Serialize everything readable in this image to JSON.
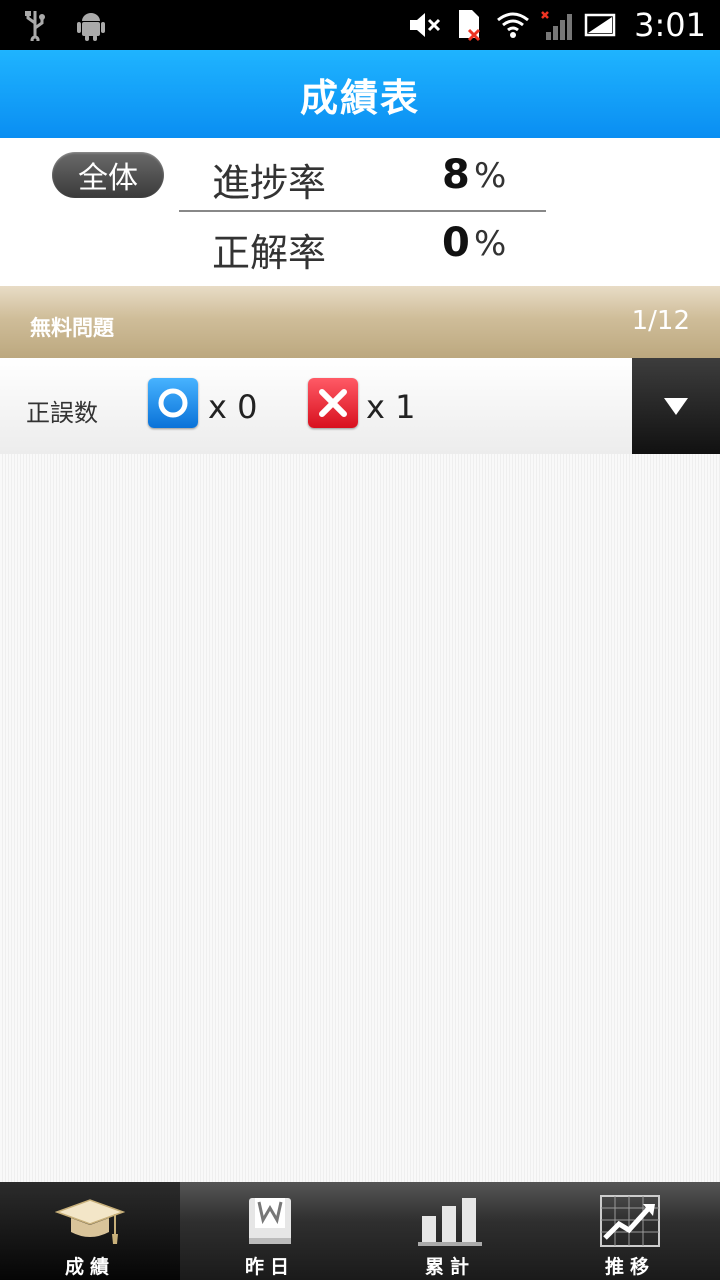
{
  "status_bar": {
    "time": "3:01"
  },
  "header": {
    "title": "成績表"
  },
  "summary": {
    "scope": "全体",
    "progress_label": "進捗率",
    "progress_value": "8",
    "correct_rate_label": "正解率",
    "correct_rate_value": "0",
    "percent_unit": "%"
  },
  "section": {
    "title": "無料問題",
    "page": "1/12"
  },
  "answers": {
    "label": "正誤数",
    "correct_count": "x 0",
    "wrong_count": "x 1"
  },
  "nav": {
    "tabs": [
      {
        "label": "成績",
        "icon": "graduation-cap-icon",
        "active": true
      },
      {
        "label": "昨日",
        "icon": "book-icon",
        "active": false
      },
      {
        "label": "累計",
        "icon": "bar-chart-icon",
        "active": false
      },
      {
        "label": "推移",
        "icon": "trend-chart-icon",
        "active": false
      }
    ]
  },
  "colors": {
    "header_blue": "#0a8ef2",
    "correct_blue": "#0a72d8",
    "wrong_red": "#d8101e",
    "section_gold": "#bca87f"
  }
}
